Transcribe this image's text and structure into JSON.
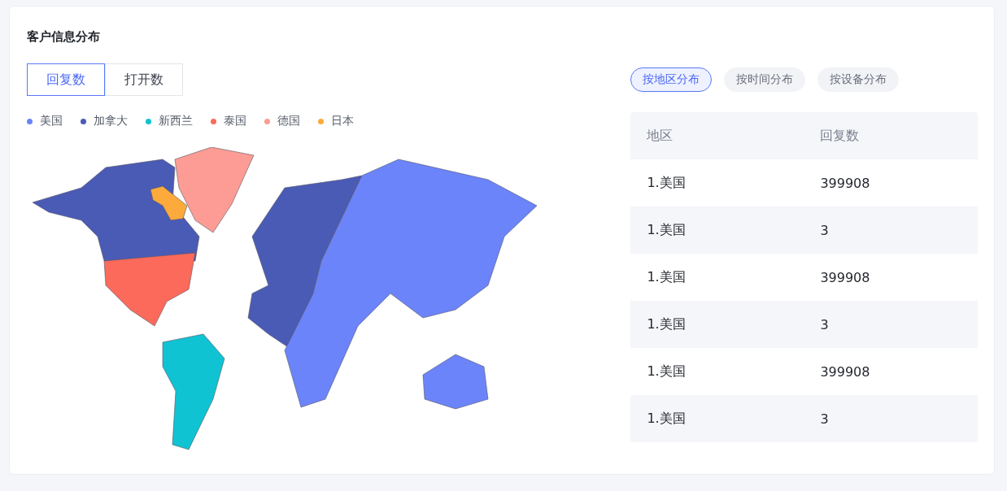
{
  "card": {
    "title": "客户信息分布"
  },
  "metric_tabs": [
    {
      "label": "回复数",
      "selected": true
    },
    {
      "label": "打开数",
      "selected": false
    }
  ],
  "legend": [
    {
      "label": "美国",
      "color": "#6b84f9"
    },
    {
      "label": "加拿大",
      "color": "#4a5bb5"
    },
    {
      "label": "新西兰",
      "color": "#10c3d3"
    },
    {
      "label": "泰国",
      "color": "#fb6a5a"
    },
    {
      "label": "德国",
      "color": "#fc9c94"
    },
    {
      "label": "日本",
      "color": "#fcaa3c"
    }
  ],
  "view_tabs": [
    {
      "label": "按地区分布",
      "selected": true
    },
    {
      "label": "按时间分布",
      "selected": false
    },
    {
      "label": "按设备分布",
      "selected": false
    }
  ],
  "table": {
    "columns": [
      "地区",
      "回复数"
    ],
    "rows": [
      [
        "1.美国",
        "399908"
      ],
      [
        "1.美国",
        "3"
      ],
      [
        "1.美国",
        "399908"
      ],
      [
        "1.美国",
        "3"
      ],
      [
        "1.美国",
        "399908"
      ],
      [
        "1.美国",
        "3"
      ]
    ]
  }
}
